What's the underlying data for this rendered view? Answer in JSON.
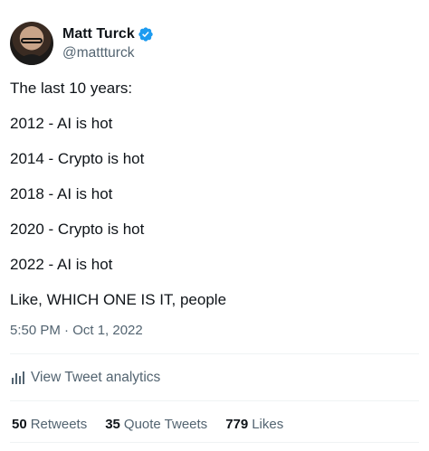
{
  "author": {
    "display_name": "Matt Turck",
    "handle": "@mattturck",
    "verified_color": "#1d9bf0"
  },
  "tweet": {
    "lines": [
      "The last 10 years:",
      "2012 - AI is hot",
      "2014 - Crypto is hot",
      "2018 - AI is hot",
      "2020 - Crypto is hot",
      "2022 - AI is hot",
      "Like, WHICH ONE IS IT, people"
    ],
    "timestamp": "5:50 PM · Oct 1, 2022"
  },
  "analytics": {
    "label": "View Tweet analytics",
    "icon": "bar-chart-icon"
  },
  "stats": [
    {
      "count": "50",
      "label": "Retweets"
    },
    {
      "count": "35",
      "label": "Quote Tweets"
    },
    {
      "count": "779",
      "label": "Likes"
    }
  ]
}
